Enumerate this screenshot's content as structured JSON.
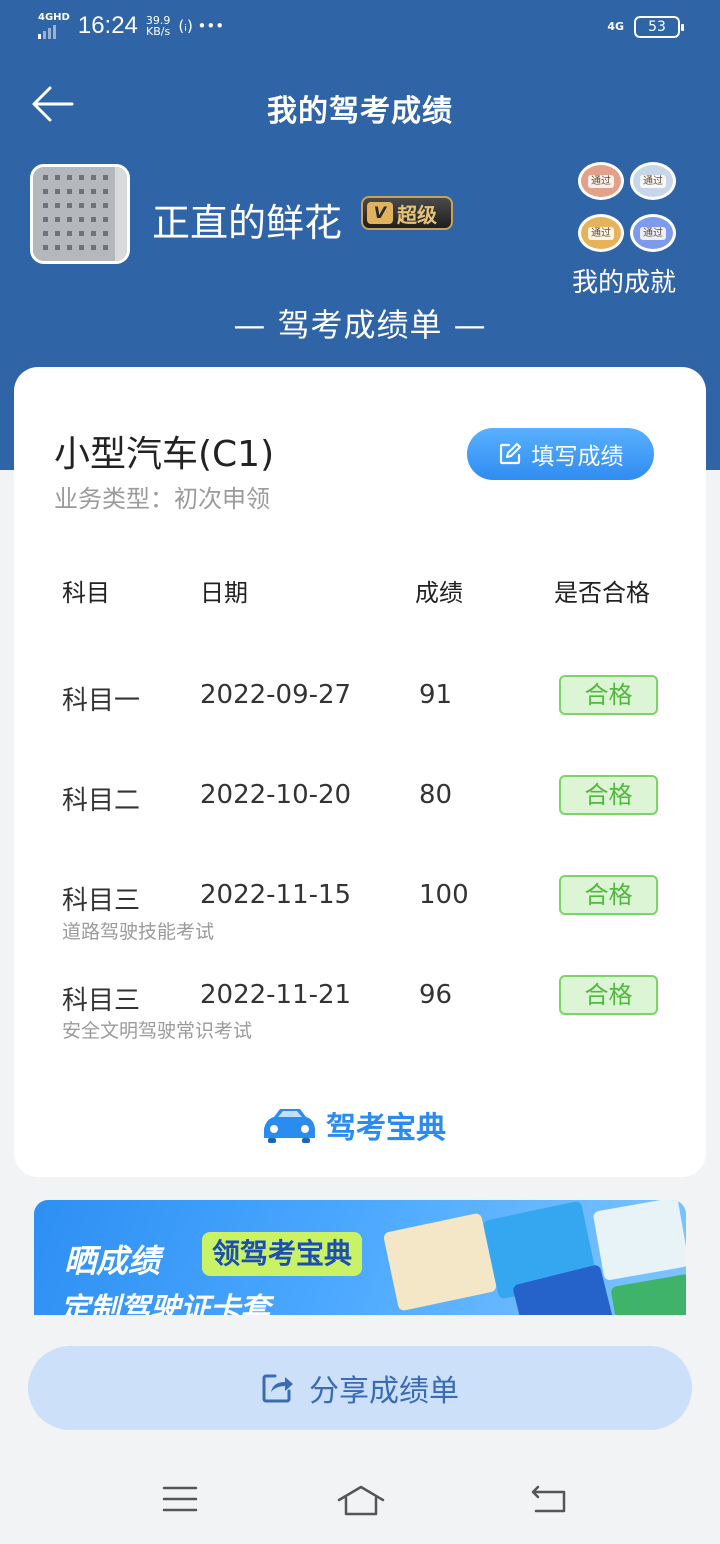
{
  "status_bar": {
    "network": "4GHD",
    "time": "16:24",
    "speed_value": "39.9",
    "speed_unit": "KB/s",
    "extra": "(ᵢ) •••",
    "right_network": "4G",
    "battery": "53"
  },
  "header": {
    "title": "我的驾考成绩"
  },
  "profile": {
    "username": "正直的鲜花",
    "vip_label": "超级",
    "vip_letter": "V",
    "medal_text": "通过",
    "achievements_label": "我的成就"
  },
  "section_title": "— 驾考成绩单 —",
  "card": {
    "license_type": "小型汽车(C1)",
    "business_type": "业务类型：初次申领",
    "fill_button": "填写成绩",
    "columns": [
      "科目",
      "日期",
      "成绩",
      "是否合格"
    ],
    "rows": [
      {
        "subject": "科目一",
        "date": "2022-09-27",
        "score": "91",
        "result": "合格",
        "note": ""
      },
      {
        "subject": "科目二",
        "date": "2022-10-20",
        "score": "80",
        "result": "合格",
        "note": ""
      },
      {
        "subject": "科目三",
        "date": "2022-11-15",
        "score": "100",
        "result": "合格",
        "note": "道路驾驶技能考试"
      },
      {
        "subject": "科目三",
        "date": "2022-11-21",
        "score": "96",
        "result": "合格",
        "note": "安全文明驾驶常识考试"
      }
    ],
    "brand": "驾考宝典"
  },
  "banner": {
    "line1": "晒成绩",
    "tag": "领驾考宝典",
    "line2": "定制驾驶证卡套"
  },
  "share_button": "分享成绩单",
  "colors": {
    "header_blue": "#2f64a7",
    "pass_green": "#53b83f",
    "brand_blue": "#2b8cf0"
  },
  "icons": {
    "back": "arrow-left-icon",
    "edit": "edit-icon",
    "share": "share-icon",
    "nav_menu": "menu-icon",
    "nav_home": "home-icon",
    "nav_back": "back-icon"
  }
}
